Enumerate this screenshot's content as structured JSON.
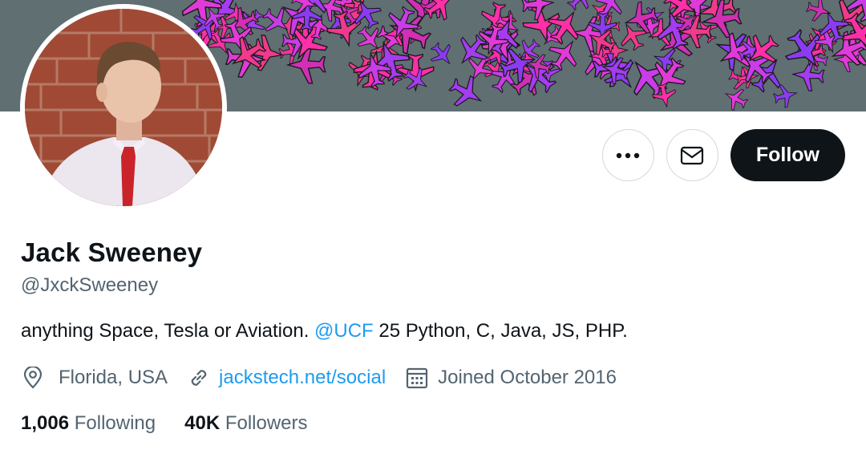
{
  "colors": {
    "banner_bg": "#5f6f72",
    "accent_link": "#1d9bf0",
    "text_primary": "#0f1419",
    "text_secondary": "#536471",
    "follow_bg": "#0f1419"
  },
  "profile": {
    "name": "Jack Sweeney",
    "handle": "@JxckSweeney",
    "bio_before": "anything Space, Tesla or Aviation. ",
    "bio_mention": "@UCF",
    "bio_after": " 25 Python, C, Java, JS, PHP.",
    "location": "Florida, USA",
    "website": "jackstech.net/social",
    "joined": "Joined October 2016"
  },
  "actions": {
    "more_icon": "more-horizontal-icon",
    "message_icon": "envelope-icon",
    "follow_label": "Follow"
  },
  "stats": {
    "following_count": "1,006",
    "following_label": "Following",
    "followers_count": "40K",
    "followers_label": "Followers"
  },
  "icons": {
    "location": "location-pin-icon",
    "link": "link-icon",
    "calendar": "calendar-icon"
  }
}
